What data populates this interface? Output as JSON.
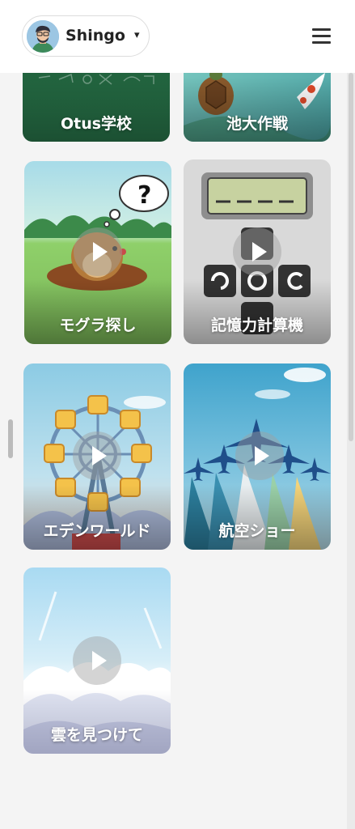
{
  "header": {
    "username": "Shingo",
    "caret": "▾",
    "avatar_icon": "user-avatar-icon",
    "menu_icon": "hamburger-menu-icon"
  },
  "games": [
    {
      "label": "Otus学校",
      "play_button": false
    },
    {
      "label": "池大作戦",
      "play_button": false
    },
    {
      "label": "モグラ探し",
      "play_button": true
    },
    {
      "label": "記憶力計算機",
      "play_button": true
    },
    {
      "label": "エデンワールド",
      "play_button": true
    },
    {
      "label": "航空ショー",
      "play_button": true
    },
    {
      "label": "雲を見つけて",
      "play_button": true
    }
  ],
  "colors": {
    "header_bg": "#ffffff",
    "page_bg": "#f4f4f4",
    "otus_green": "#1f6a3e",
    "pond_teal": "#6dbdb6",
    "sky_blue": "#8ccbe4"
  }
}
